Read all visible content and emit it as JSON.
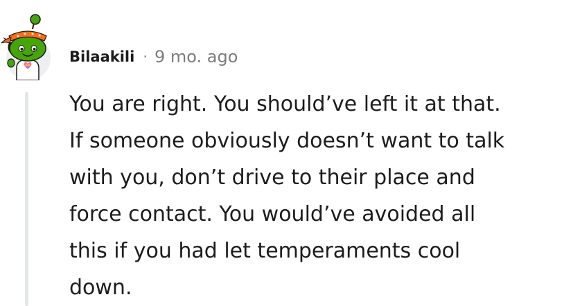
{
  "comment": {
    "username": "Bilaakili",
    "separator": "·",
    "timestamp": "9 mo. ago",
    "avatar_icon": "reddit-snoo-avatar-icon",
    "body_lines": [
      "You are right. You should’ve left it at that.",
      "If someone obviously doesn’t want to talk",
      "with you, don’t drive to their place and",
      "force contact. You would’ve avoided all",
      "this if you had let temperaments cool",
      "down."
    ]
  },
  "colors": {
    "text_primary": "#1c1c1c",
    "text_secondary": "#7c7c7c",
    "thread_line": "#e4e6e8",
    "avatar_skin": "#46a508",
    "avatar_bg": "#edeff1"
  }
}
